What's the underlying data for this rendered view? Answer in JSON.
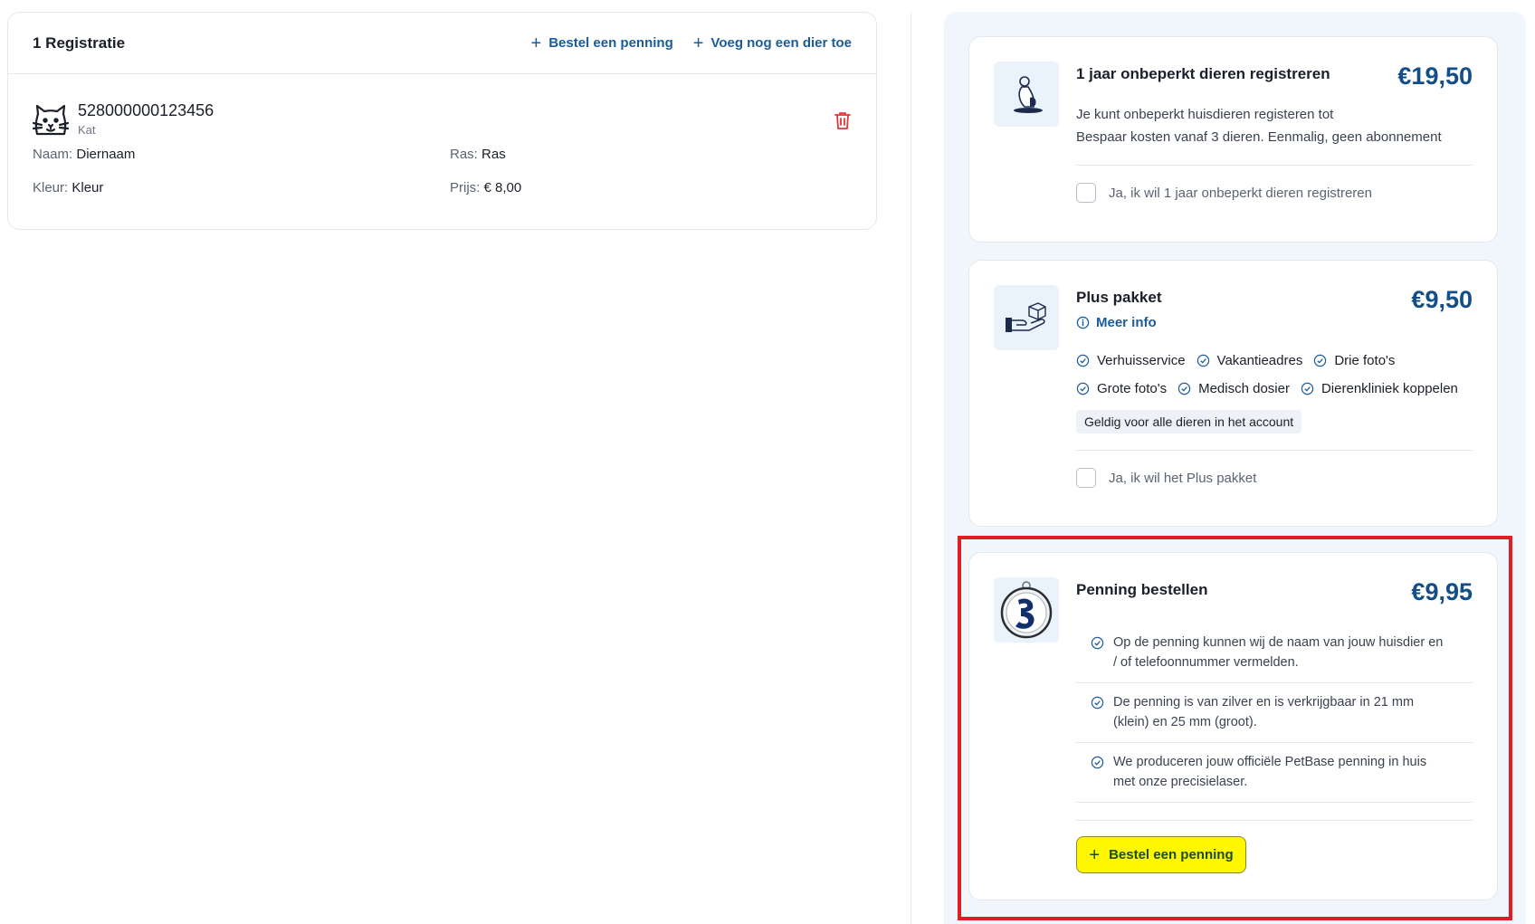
{
  "registration": {
    "title": "1 Registratie",
    "actions": [
      {
        "label": "Bestel een penning"
      },
      {
        "label": "Voeg nog een dier toe"
      }
    ],
    "animal": {
      "chip": "528000000123456",
      "species": "Kat",
      "fields": {
        "naam_label": "Naam:",
        "naam_value": "Diernaam",
        "ras_label": "Ras:",
        "ras_value": "Ras",
        "kleur_label": "Kleur:",
        "kleur_value": "Kleur",
        "prijs_label": "Prijs:",
        "prijs_value": "€ 8,00"
      }
    }
  },
  "options": {
    "unlimited": {
      "title": "1 jaar onbeperkt dieren registreren",
      "price": "€19,50",
      "desc_line1": "Je kunt onbeperkt huisdieren registeren tot",
      "desc_line2": "Bespaar kosten vanaf 3 dieren. Eenmalig, geen abonnement",
      "checkbox_label": "Ja, ik wil 1 jaar onbeperkt dieren registreren"
    },
    "plus": {
      "title": "Plus pakket",
      "price": "€9,50",
      "meer_info": "Meer info",
      "features_row1": [
        "Verhuisservice",
        "Vakantieadres",
        "Drie foto's"
      ],
      "features_row2": [
        "Grote foto's",
        "Medisch dosier",
        "Dierenkliniek koppelen"
      ],
      "badge": "Geldig voor alle dieren in het account",
      "checkbox_label": "Ja, ik wil het Plus pakket"
    },
    "penning": {
      "title": "Penning bestellen",
      "price": "€9,95",
      "items": [
        {
          "line1": "Op de penning kunnen wij de naam van jouw huisdier en",
          "line2": "/ of telefoonnummer vermelden."
        },
        {
          "line1": "De penning is van zilver en is verkrijgbaar in 21 mm",
          "line2": "(klein) en 25 mm (groot)."
        },
        {
          "line1": "We produceren jouw officiële PetBase penning in huis",
          "line2": "met onze precisielaser."
        }
      ],
      "button_label": "Bestel een penning"
    }
  },
  "colors": {
    "brand": "#124e88",
    "link": "#1a5c9a",
    "highlight_button": "#fff700",
    "annotation_box": "#e31b23",
    "delete": "#e0343a"
  }
}
